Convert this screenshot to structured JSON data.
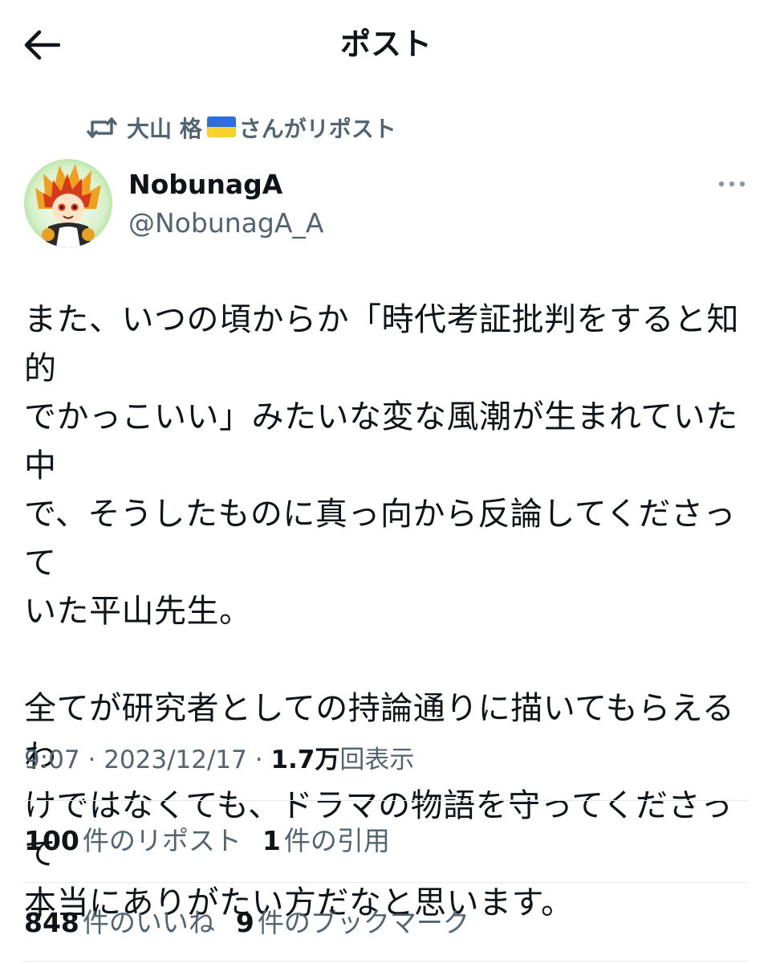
{
  "header": {
    "title": "ポスト",
    "back_icon": "arrow-left-icon"
  },
  "repost_context": {
    "icon": "repost-icon",
    "user_name": "大山 格",
    "flag_icon": "ukraine-flag-icon",
    "suffix": "さんがリポスト"
  },
  "author": {
    "display_name": "NobunagA",
    "handle": "@NobunagA_A",
    "more_icon": "more-dots-icon"
  },
  "tweet": {
    "paragraphs": [
      "また、いつの頃からか「時代考証批判をすると知的\nでかっこいい」みたいな変な風潮が生まれていた中\nで、そうしたものに真っ向から反論してくださって\nいた平山先生。",
      "全てが研究者としての持論通りに描いてもらえるわ\nけではなくても、ドラマの物語を守ってくださって\n本当にありがたい方だなと思います。"
    ]
  },
  "meta": {
    "time": "9:07",
    "sep1": " · ",
    "date": "2023/12/17",
    "sep2": " · ",
    "views": "1.7万",
    "views_label": "回表示"
  },
  "stats": {
    "reposts_count": "100",
    "reposts_label": "件のリポスト",
    "quotes_count": "1",
    "quotes_label": "件の引用",
    "likes_count": "848",
    "likes_label": "件のいいね",
    "bookmarks_count": "9",
    "bookmarks_label": "件のブックマーク"
  },
  "colors": {
    "text_primary": "#0f1419",
    "text_secondary": "#536471",
    "divider": "#e6e9eb",
    "flag_blue": "#2a6fdb",
    "flag_yellow": "#f7d12e"
  }
}
